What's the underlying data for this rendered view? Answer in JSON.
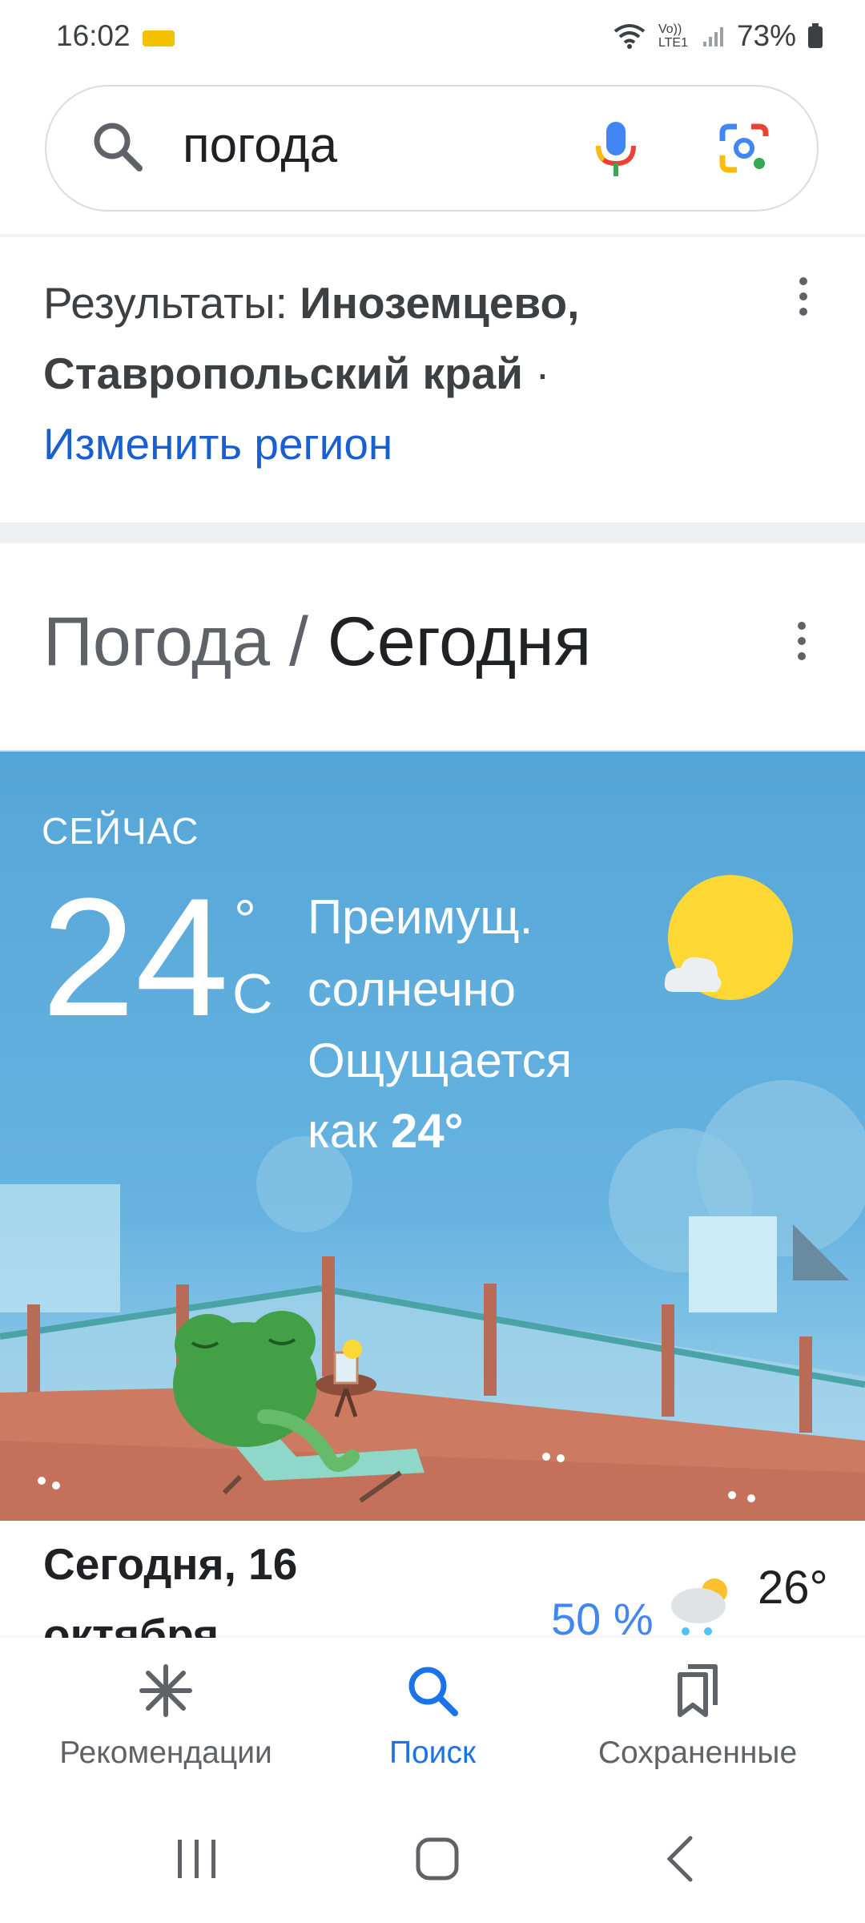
{
  "status_bar": {
    "time": "16:02",
    "network": "Vo)) LTE1",
    "battery": "73%"
  },
  "search": {
    "query": "погода"
  },
  "location": {
    "prefix": "Результаты: ",
    "place": "Иноземцево, Ставропольский край",
    "separator": " · ",
    "change_link": "Изменить регион"
  },
  "weather_header": {
    "part1": "Погода",
    "slash": " / ",
    "part2": "Сегодня"
  },
  "current": {
    "label": "СЕЙЧАС",
    "temperature": "24",
    "degree": "°",
    "unit": "C",
    "condition": "Преимущ. солнечно",
    "feels_prefix": "Ощущается как ",
    "feels_value": "24°"
  },
  "today": {
    "date": "Сегодня, 16 октября",
    "precipitation": "50 %",
    "high": "26°"
  },
  "bottom_nav": {
    "items": [
      {
        "label": "Рекомендации",
        "icon": "asterisk-icon"
      },
      {
        "label": "Поиск",
        "icon": "search-icon",
        "active": true
      },
      {
        "label": "Сохраненные",
        "icon": "bookmarks-icon"
      }
    ]
  },
  "colors": {
    "sky": "#55a6d8",
    "link": "#1a5fd0",
    "active_nav": "#1a73e8",
    "precip": "#4285f4"
  }
}
